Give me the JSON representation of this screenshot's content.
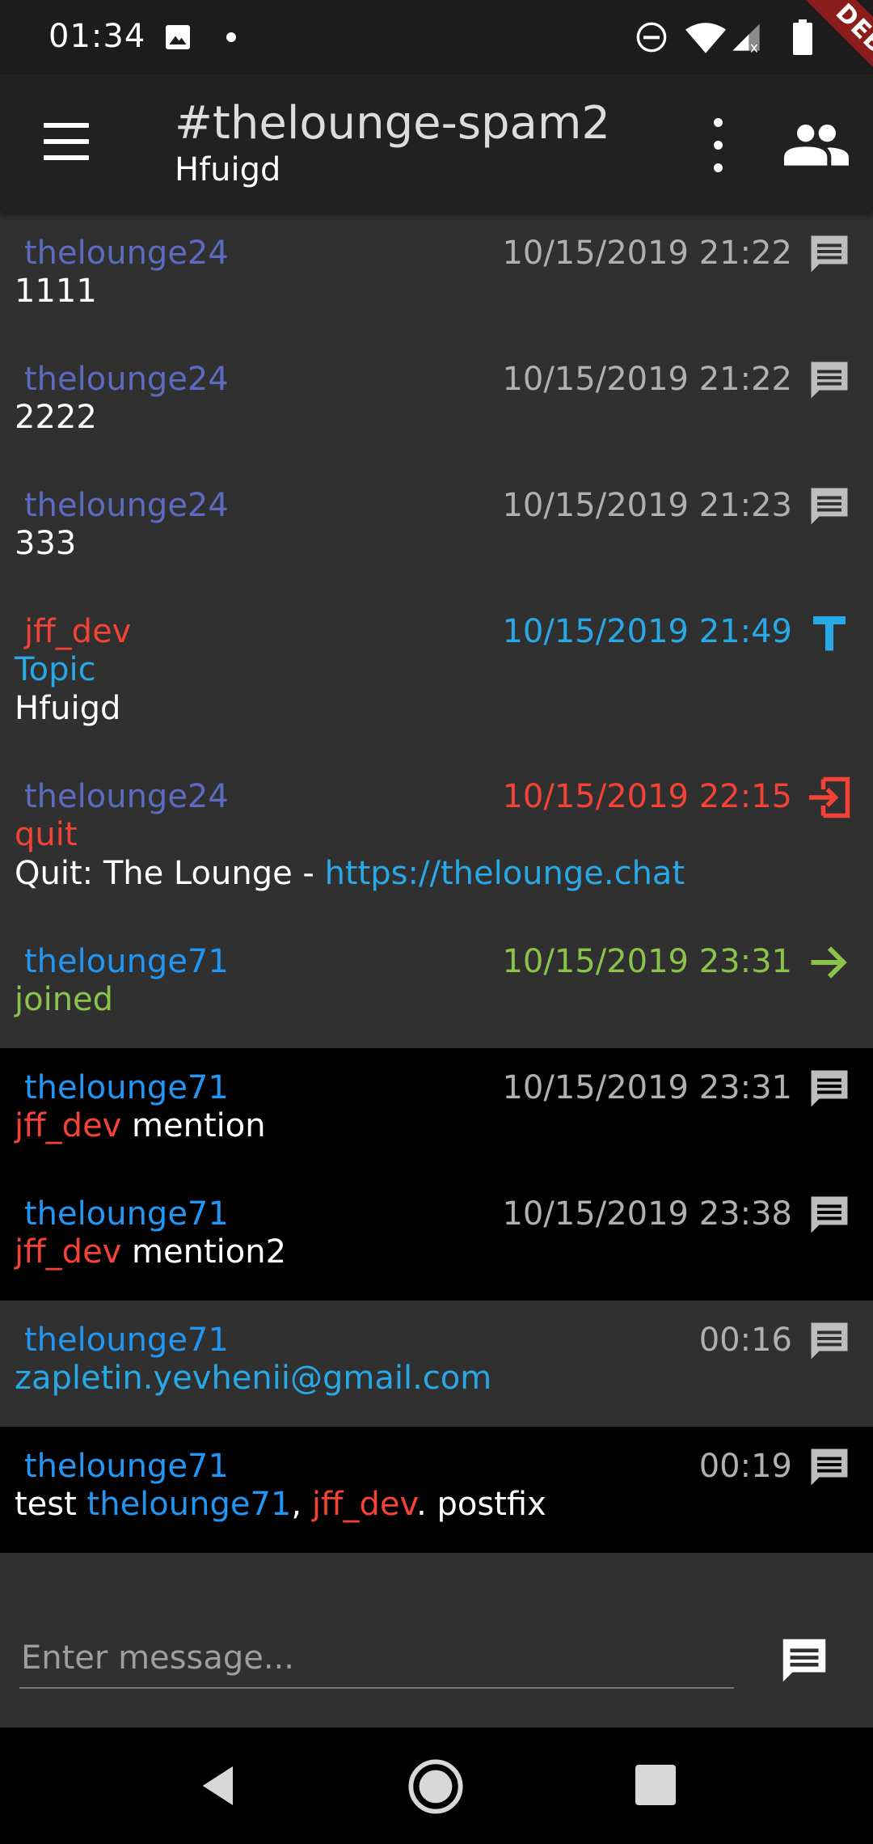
{
  "status_bar": {
    "time": "01:34",
    "debug_label": "DEBUG"
  },
  "app_bar": {
    "title": "#thelounge-spam2",
    "subtitle": "Hfuigd"
  },
  "messages": [
    {
      "nick": "thelounge24",
      "time": "10/15/2019 21:22",
      "icon": "chat-icon",
      "body": "1111"
    },
    {
      "nick": "thelounge24",
      "time": "10/15/2019 21:22",
      "icon": "chat-icon",
      "body": "2222"
    },
    {
      "nick": "thelounge24",
      "time": "10/15/2019 21:23",
      "icon": "chat-icon",
      "body": "333"
    },
    {
      "nick": "jff_dev",
      "time": "10/15/2019 21:49",
      "icon": "topic-icon",
      "label": "Topic",
      "body": "Hfuigd"
    },
    {
      "nick": "thelounge24",
      "time": "10/15/2019 22:15",
      "icon": "quit-icon",
      "label": "quit",
      "body_prefix": "Quit: The Lounge - ",
      "body_link": "https://thelounge.chat"
    },
    {
      "nick": "thelounge71",
      "time": "10/15/2019 23:31",
      "icon": "join-icon",
      "label": "joined"
    },
    {
      "nick": "thelounge71",
      "time": "10/15/2019 23:31",
      "icon": "chat-icon",
      "mention": "jff_dev",
      "body": " mention"
    },
    {
      "nick": "thelounge71",
      "time": "10/15/2019 23:38",
      "icon": "chat-icon",
      "mention": "jff_dev",
      "body": " mention2"
    },
    {
      "nick": "thelounge71",
      "time": "00:16",
      "icon": "chat-icon",
      "body_link": "zapletin.yevhenii@gmail.com"
    },
    {
      "nick": "thelounge71",
      "time": "00:19",
      "icon": "chat-icon",
      "body_a": "test ",
      "mention_a": "thelounge71",
      "body_b": ", ",
      "mention_b": "jff_dev",
      "body_c": ". postfix"
    }
  ],
  "input": {
    "placeholder": "Enter message..."
  },
  "colors": {
    "nick_thelounge24": "#5c6bc0",
    "nick_thelounge71": "#2196f3",
    "nick_jff_dev": "#f44336",
    "topic": "#29a8e6",
    "quit": "#f44336",
    "join": "#8bc34a",
    "highlight_bg": "#000000",
    "background": "#303030"
  }
}
